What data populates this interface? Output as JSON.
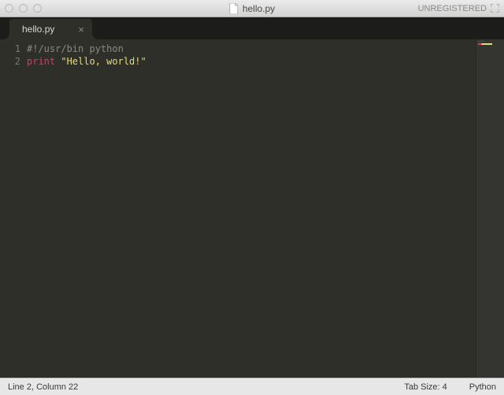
{
  "window": {
    "title": "hello.py",
    "registration": "UNREGISTERED"
  },
  "tabs": [
    {
      "label": "hello.py"
    }
  ],
  "editor": {
    "lines": [
      {
        "num": "1",
        "tokens": [
          {
            "cls": "comment",
            "t": "#!/usr/bin python"
          }
        ]
      },
      {
        "num": "2",
        "tokens": [
          {
            "cls": "keyword",
            "t": "print"
          },
          {
            "cls": "",
            "t": " "
          },
          {
            "cls": "string",
            "t": "\"Hello, world!\""
          }
        ]
      }
    ]
  },
  "status": {
    "position": "Line 2, Column 22",
    "tab_size": "Tab Size: 4",
    "language": "Python"
  }
}
